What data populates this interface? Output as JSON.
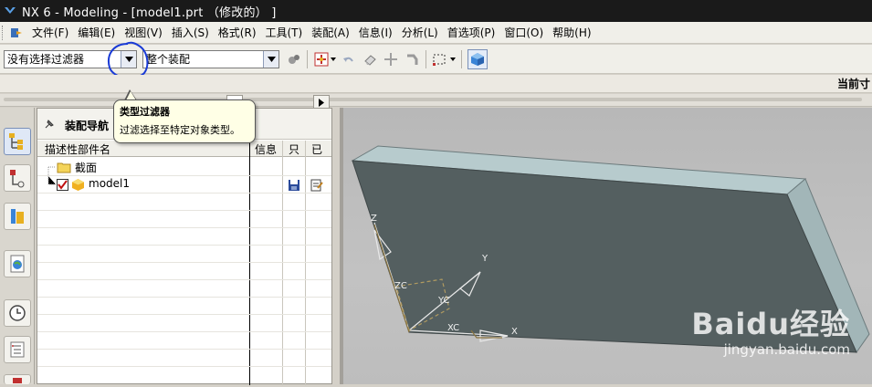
{
  "window": {
    "title": "NX 6 - Modeling - [model1.prt （修改的） ]"
  },
  "menubar": {
    "items": [
      {
        "label": "文件(F)"
      },
      {
        "label": "编辑(E)"
      },
      {
        "label": "视图(V)"
      },
      {
        "label": "插入(S)"
      },
      {
        "label": "格式(R)"
      },
      {
        "label": "工具(T)"
      },
      {
        "label": "装配(A)"
      },
      {
        "label": "信息(I)"
      },
      {
        "label": "分析(L)"
      },
      {
        "label": "首选项(P)"
      },
      {
        "label": "窗口(O)"
      },
      {
        "label": "帮助(H)"
      }
    ]
  },
  "toolbar": {
    "type_filter_value": "没有选择过滤器",
    "scope_value": "整个装配"
  },
  "status_strip": {
    "current_label": "当前寸"
  },
  "tooltip": {
    "title": "类型过滤器",
    "body": "过滤选择至特定对象类型。"
  },
  "navigator": {
    "title": "装配导航",
    "columns": {
      "name": "描述性部件名",
      "info": "信息",
      "readonly": "只",
      "modified": "已"
    },
    "rows": [
      {
        "name": "截面",
        "icon": "folder-icon"
      },
      {
        "name": "model1",
        "icon": "part-icon",
        "checked": true
      }
    ]
  },
  "viewport": {
    "axis_labels": {
      "z": "Z",
      "y": "Y",
      "x": "X",
      "zc": "ZC",
      "yc": "YC",
      "xc": "XC"
    }
  },
  "watermark": {
    "brand": "Baidu经验",
    "url": "jingyan.baidu.com"
  },
  "colors": {
    "titlebar": "#1a1a1a",
    "plate_top": "#b7cbcd",
    "plate_face": "#545f60",
    "plate_side": "#a2b6b8",
    "annotation_circle": "#1a3bd6"
  }
}
